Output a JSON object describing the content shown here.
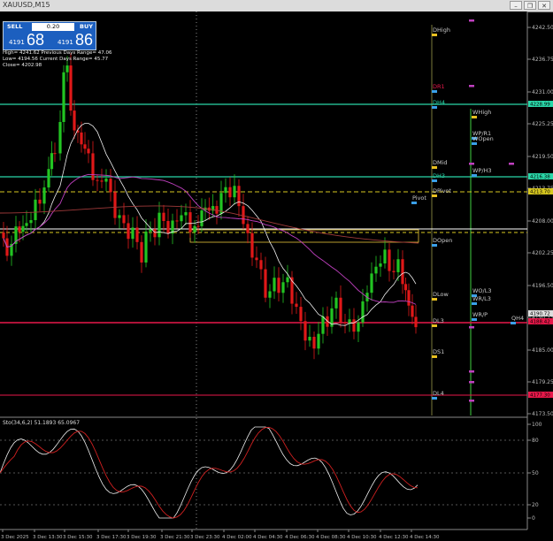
{
  "window": {
    "title": "XAUUSD,M15"
  },
  "trade_panel": {
    "sell_label": "SELL",
    "buy_label": "BUY",
    "lot": "0.20",
    "sell_small": "4191",
    "sell_big": "68",
    "buy_small": "4191",
    "buy_big": "86"
  },
  "info": {
    "line1": "High= 4241.62    Previous Days Range= 47.06",
    "line2": "Low= 4194.56    Current Days Range= 45.77",
    "line3": "Close= 4202.98"
  },
  "osc_label": "Sto(34,6,2) 51.1893 65.0967",
  "price_labels": [
    "4242.50",
    "4236.75",
    "4231.00",
    "4225.25",
    "4219.50",
    "4213.75",
    "4208.00",
    "4202.25",
    "4196.50",
    "4190.75",
    "4185.00",
    "4179.25",
    "4173.50"
  ],
  "osc_levels": [
    "100",
    "80",
    "50",
    "20",
    "0"
  ],
  "time_labels": [
    "3 Dec 2025",
    "3 Dec 13:30",
    "3 Dec 15:30",
    "3 Dec 17:30",
    "3 Dec 19:30",
    "3 Dec 21:30",
    "3 Dec 23:30",
    "4 Dec 02:00",
    "4 Dec 04:30",
    "4 Dec 06:30",
    "4 Dec 08:30",
    "4 Dec 10:30",
    "4 Dec 12:30",
    "4 Dec 14:30"
  ],
  "levels": [
    {
      "name": "DHigh",
      "color": "#c9c9c9"
    },
    {
      "name": "DR1",
      "color": "#e8184a"
    },
    {
      "name": "DH4",
      "color": "#2ad6a8"
    },
    {
      "name": "WHigh",
      "color": "#c9c9c9"
    },
    {
      "name": "WP/R1",
      "color": "#c9c9c9"
    },
    {
      "name": "WOpen",
      "color": "#c9c9c9"
    },
    {
      "name": "DMid",
      "color": "#c9c9c9"
    },
    {
      "name": "WP/H3",
      "color": "#c9c9c9"
    },
    {
      "name": "DH3",
      "color": "#2ad6a8"
    },
    {
      "name": "DPivot",
      "color": "#c9c9c9"
    },
    {
      "name": "Pivot",
      "color": "#c9c9c9"
    },
    {
      "name": "DOpen",
      "color": "#c9c9c9"
    },
    {
      "name": "DLow",
      "color": "#c9c9c9"
    },
    {
      "name": "WO/L3",
      "color": "#c9c9c9"
    },
    {
      "name": "WR/L3",
      "color": "#c9c9c9"
    },
    {
      "name": "DL3",
      "color": "#c9c9c9"
    },
    {
      "name": "WR/P",
      "color": "#c9c9c9"
    },
    {
      "name": "QH4",
      "color": "#c9c9c9"
    },
    {
      "name": "DS1",
      "color": "#c9c9c9"
    },
    {
      "name": "DL4",
      "color": "#c9c9c9"
    }
  ],
  "right_tags": [
    {
      "text": "4228.99",
      "color": "#2ad6a8"
    },
    {
      "text": "4216.38",
      "color": "#2ad6a8"
    },
    {
      "text": "4213.70",
      "color": "#d8c820"
    },
    {
      "text": "4190.72",
      "color": "#dddddd"
    },
    {
      "text": "4188.42",
      "color": "#e8184a"
    },
    {
      "text": "4177.30",
      "color": "#e8184a"
    }
  ]
}
